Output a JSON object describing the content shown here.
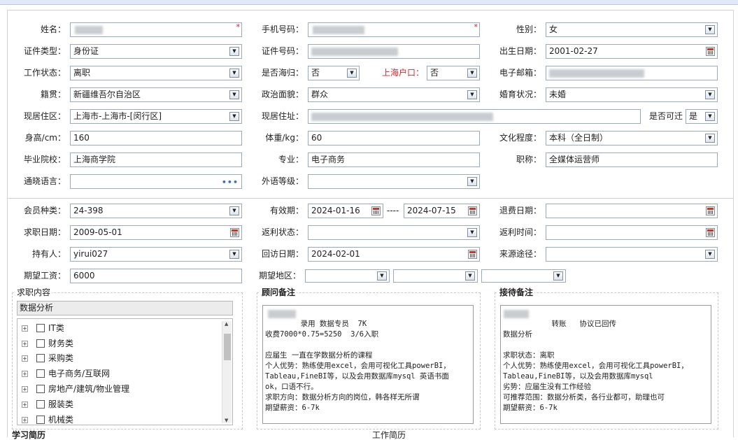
{
  "form": {
    "name_label": "姓名：",
    "name_value": "",
    "phone_label": "手机号码：",
    "phone_value": "",
    "gender_label": "性别：",
    "gender_value": "女",
    "idtype_label": "证件类型：",
    "idtype_value": "身份证",
    "idno_label": "证件号码：",
    "idno_value": "",
    "birth_label": "出生日期：",
    "birth_value": "2001-02-27",
    "workstatus_label": "工作状态：",
    "workstatus_value": "离职",
    "returnee_label": "是否海归：",
    "returnee_value": "否",
    "shhukou_label": "上海户口：",
    "shhukou_value": "否",
    "email_label": "电子邮箱：",
    "email_value": "",
    "native_label": "籍贯：",
    "native_value": "新疆维吾尔自治区",
    "political_label": "政治面貌：",
    "political_value": "群众",
    "marital_label": "婚育状况：",
    "marital_value": "未婚",
    "residence_label": "现居住区：",
    "residence_value": "上海市-上海市-[闵行区]",
    "address_label": "现居住址：",
    "address_value": "",
    "relocate_label": "是否可迁",
    "relocate_value": "是",
    "height_label": "身高/cm：",
    "height_value": "160",
    "weight_label": "体重/kg：",
    "weight_value": "60",
    "education_label": "文化程度：",
    "education_value": "本科（全日制）",
    "school_label": "毕业院校：",
    "school_value": "上海商学院",
    "major_label": "专业：",
    "major_value": "电子商务",
    "title_label": "职称：",
    "title_value": "全媒体运营师",
    "language_label": "通晓语言：",
    "language_value": "",
    "foreign_label": "外语等级：",
    "foreign_value": ""
  },
  "member": {
    "type_label": "会员种类：",
    "type_value": "24-398",
    "valid_label": "有效期：",
    "valid_from": "2024-01-16",
    "valid_sep": "----",
    "valid_to": "2024-07-15",
    "refund_label": "退费日期：",
    "refund_value": "",
    "jobdate_label": "求职日期：",
    "jobdate_value": "2009-05-01",
    "rebate_status_label": "返利状态：",
    "rebate_status_value": "",
    "rebate_time_label": "返利时间：",
    "rebate_time_value": "",
    "holder_label": "持有人：",
    "holder_value": "yirui027",
    "visit_label": "回访日期：",
    "visit_value": "2024-02-01",
    "source_label": "来源途径：",
    "source_value": "",
    "salary_label": "期望工资：",
    "salary_value": "6000",
    "region_label": "期望地区："
  },
  "job_content": {
    "title": "求职内容",
    "search_value": "数据分析",
    "tree": [
      "IT类",
      "财务类",
      "采购类",
      "电子商务/互联网",
      "房地产/建筑/物业管理",
      "服装类",
      "机械类"
    ]
  },
  "advisor_note": {
    "title": "顾问备注",
    "text": "      录用 数据专员  7K\n收费7000*0.75=5250  3/6入职\n\n应届生 一直在学数据分析的课程\n个人优势：熟练使用excel，会用可视化工具powerBI，\nTableau,FineBI等，以及会用数据库mysql 英语书面\nok，口语不行。\n求职方向：数据分析方向的岗位，韩各样无所谓\n期望薪资：6-7k"
  },
  "reception_note": {
    "title": "接待备注",
    "text": "         转账   协议已回传\n数据分析\n\n求职状态：离职\n个人优势：熟练使用excel，会用可视化工具powerBI，\nTableau,FineBI等，以及会用数据库mysql\n劣势：应届生没有工作经验\n可推荐范围：数据分析类，各行业都可，助理也可\n期望薪资：6-7k"
  },
  "bottom": {
    "study_title": "学习简历",
    "work_title": "工作简历"
  }
}
